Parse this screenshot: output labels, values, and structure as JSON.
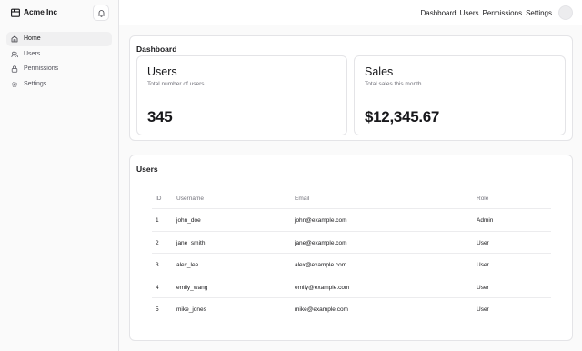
{
  "brand": {
    "name": "Acme Inc"
  },
  "sidebar": {
    "items": [
      {
        "label": "Home",
        "icon": "home-icon",
        "active": true
      },
      {
        "label": "Users",
        "icon": "users-icon",
        "active": false
      },
      {
        "label": "Permissions",
        "icon": "lock-icon",
        "active": false
      },
      {
        "label": "Settings",
        "icon": "gear-icon",
        "active": false
      }
    ]
  },
  "topnav": {
    "links": [
      "Dashboard",
      "Users",
      "Permissions",
      "Settings"
    ]
  },
  "dashboard": {
    "title": "Dashboard",
    "cards": [
      {
        "title": "Users",
        "subtitle": "Total number of users",
        "value": "345"
      },
      {
        "title": "Sales",
        "subtitle": "Total sales this month",
        "value": "$12,345.67"
      }
    ]
  },
  "users_table": {
    "title": "Users",
    "columns": [
      "ID",
      "Username",
      "Email",
      "Role"
    ],
    "rows": [
      [
        "1",
        "john_doe",
        "john@example.com",
        "Admin"
      ],
      [
        "2",
        "jane_smith",
        "jane@example.com",
        "User"
      ],
      [
        "3",
        "alex_lee",
        "alex@example.com",
        "User"
      ],
      [
        "4",
        "emily_wang",
        "emily@example.com",
        "User"
      ],
      [
        "5",
        "mike_jones",
        "mike@example.com",
        "User"
      ]
    ]
  },
  "colors": {
    "border": "#e4e4e7",
    "sidebar_bg": "#fafafa",
    "active_bg": "#f0f0f1",
    "muted_text": "#71717a"
  }
}
